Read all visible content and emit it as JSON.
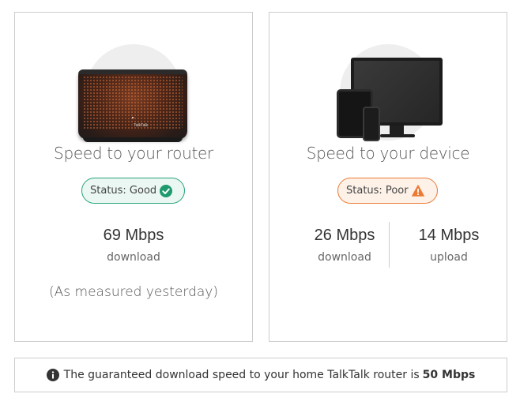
{
  "router_card": {
    "title": "Speed to your router",
    "status": "Status: Good",
    "status_color": "#27a37a",
    "download_speed": "69 Mbps",
    "download_label": "download",
    "measured_note": "(As measured yesterday)",
    "router_brand": "TalkTalk"
  },
  "device_card": {
    "title": "Speed to your device",
    "status": "Status: Poor",
    "status_color": "#ec7a35",
    "download_speed": "26 Mbps",
    "download_label": "download",
    "upload_speed": "14 Mbps",
    "upload_label": "upload"
  },
  "info": {
    "text": "The guaranteed download speed to your home TalkTalk router is",
    "value": "50 Mbps"
  }
}
